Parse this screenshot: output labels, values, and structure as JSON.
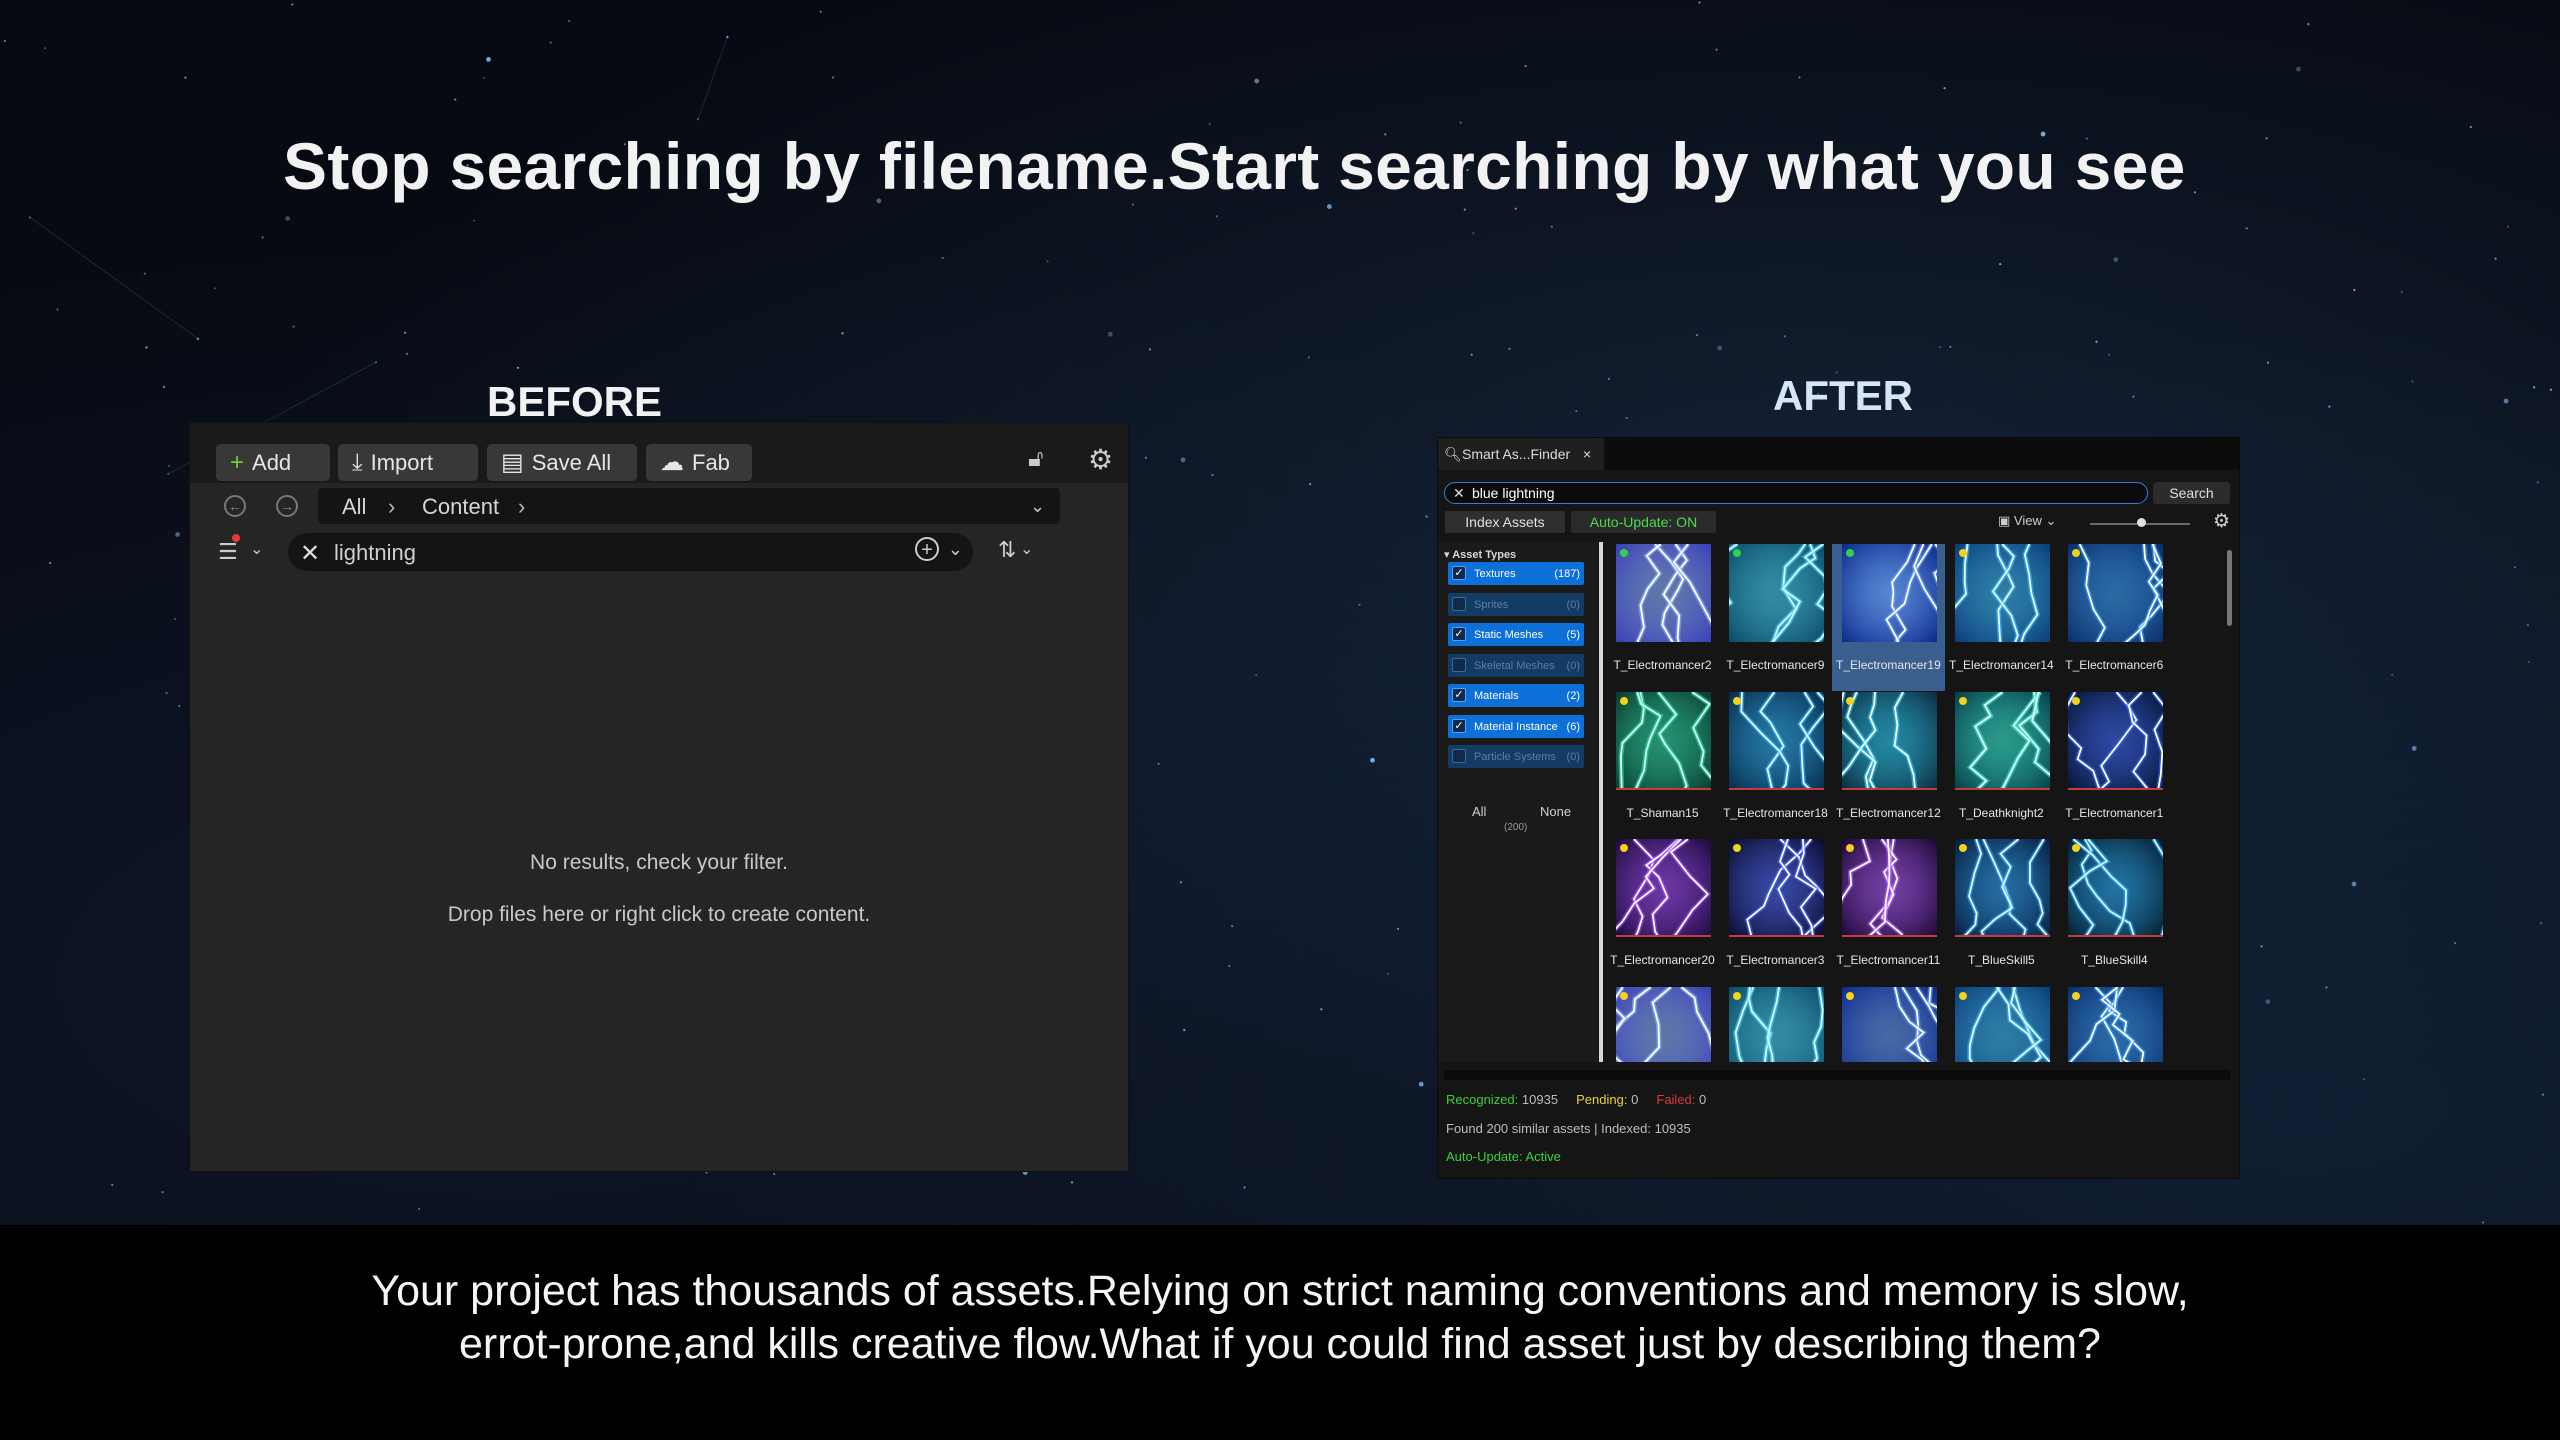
{
  "headline": "Stop searching by filename.Start searching by what you see",
  "before_label": "BEFORE",
  "after_label": "AFTER",
  "caption": [
    "Your project has thousands of assets.Relying on strict naming conventions and memory is slow,",
    "errot-prone,and kills creative flow.What if you could find asset just by describing them?"
  ],
  "before": {
    "toolbar": {
      "add": "Add",
      "import": "Import",
      "save_all": "Save All",
      "fab": "Fab"
    },
    "path": {
      "all": "All",
      "content": "Content"
    },
    "search_value": "lightning",
    "empty_line1": "No results, check your filter.",
    "empty_line2": "Drop files here or right click to create content.",
    "cross_color": "#a4552a"
  },
  "after": {
    "tab_title": "Smart As...Finder",
    "search_value": "blue lightning",
    "search_button": "Search",
    "index_button": "Index Assets",
    "auto_update_button": "Auto-Update: ON",
    "view_label": "View",
    "asset_types_header": "Asset Types",
    "filters": [
      {
        "label": "Textures",
        "count": "(187)",
        "checked": true
      },
      {
        "label": "Sprites",
        "count": "(0)",
        "checked": false
      },
      {
        "label": "Static Meshes",
        "count": "(5)",
        "checked": true
      },
      {
        "label": "Skeletal Meshes",
        "count": "(0)",
        "checked": false
      },
      {
        "label": "Materials",
        "count": "(2)",
        "checked": true
      },
      {
        "label": "Material Instance",
        "count": "(6)",
        "checked": true
      },
      {
        "label": "Particle Systems",
        "count": "(0)",
        "checked": false
      }
    ],
    "all_label": "All",
    "none_label": "None",
    "total_count": "(200)",
    "assets": [
      {
        "name": "T_Electromancer2",
        "dot": "green"
      },
      {
        "name": "T_Electromancer9",
        "dot": "green"
      },
      {
        "name": "T_Electromancer19",
        "dot": "green"
      },
      {
        "name": "T_Electromancer14",
        "dot": "yellow"
      },
      {
        "name": "T_Electromancer6",
        "dot": "yellow"
      },
      {
        "name": "T_Shaman15",
        "dot": "yellow"
      },
      {
        "name": "T_Electromancer18",
        "dot": "yellow"
      },
      {
        "name": "T_Electromancer12",
        "dot": "yellow"
      },
      {
        "name": "T_Deathknight2",
        "dot": "yellow"
      },
      {
        "name": "T_Electromancer1",
        "dot": "yellow"
      },
      {
        "name": "T_Electromancer20",
        "dot": "yellow"
      },
      {
        "name": "T_Electromancer3",
        "dot": "yellow"
      },
      {
        "name": "T_Electromancer11",
        "dot": "yellow"
      },
      {
        "name": "T_BlueSkill5",
        "dot": "yellow"
      },
      {
        "name": "T_BlueSkill4",
        "dot": "yellow"
      }
    ],
    "status": {
      "recognized_label": "Recognized:",
      "recognized_value": "10935",
      "pending_label": "Pending:",
      "pending_value": "0",
      "failed_label": "Failed:",
      "failed_value": "0",
      "found_text": "Found 200 similar assets | Indexed: 10935",
      "active_text": "Auto-Update: Active"
    }
  }
}
